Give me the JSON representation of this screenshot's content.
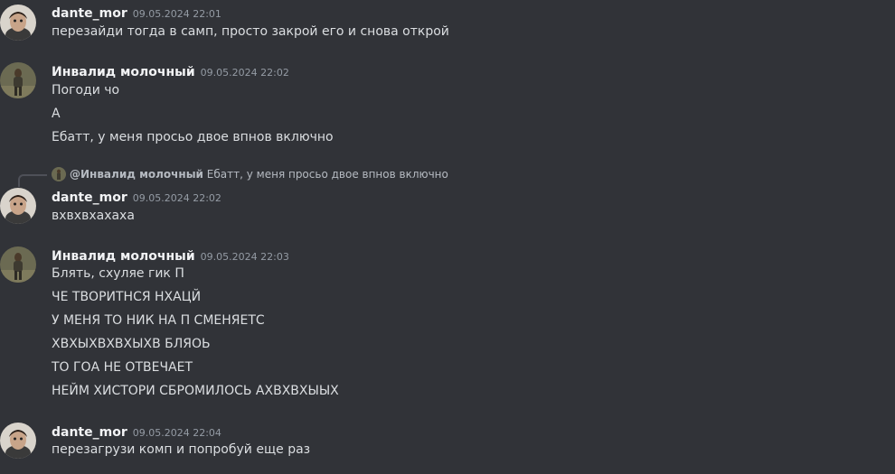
{
  "messages": [
    {
      "username": "dante_mor",
      "timestamp": "09.05.2024 22:01",
      "avatar_icon": "dante-avatar",
      "lines": [
        "перезайди тогда в самп, просто закрой его и снова открой"
      ]
    },
    {
      "username": "Инвалид молочный",
      "timestamp": "09.05.2024 22:02",
      "avatar_icon": "invalid-avatar",
      "lines": [
        "Погоди чо",
        "А",
        "Ебатт, у меня просьо двое впнов включно"
      ]
    },
    {
      "reply": {
        "mention": "@Инвалид молочный",
        "text": "Ебатт, у меня просьо двое впнов включно"
      },
      "username": "dante_mor",
      "timestamp": "09.05.2024 22:02",
      "avatar_icon": "dante-avatar",
      "lines": [
        "вхвхвхахаха"
      ]
    },
    {
      "username": "Инвалид молочный",
      "timestamp": "09.05.2024 22:03",
      "avatar_icon": "invalid-avatar",
      "lines": [
        "Блять, схуляе гик П",
        "ЧЕ ТВОРИТНСЯ НХАЦЙ",
        "У МЕНЯ ТО НИК НА П СМЕНЯЕТС",
        "ХВХЫХВХВХЫХВ БЛЯОЬ",
        "ТО ГОА НЕ ОТВЕЧАЕТ",
        "НЕЙМ ХИСТОРИ СБРОМИЛОСЬ АХВХВХЫЫХ"
      ]
    },
    {
      "username": "dante_mor",
      "timestamp": "09.05.2024 22:04",
      "avatar_icon": "dante-avatar",
      "lines": [
        "перезагрузи комп и попробуй еще раз"
      ]
    }
  ],
  "colors": {
    "background": "#313338",
    "username": "#f2f3f5",
    "timestamp": "#949ba4",
    "text": "#dbdee1"
  }
}
